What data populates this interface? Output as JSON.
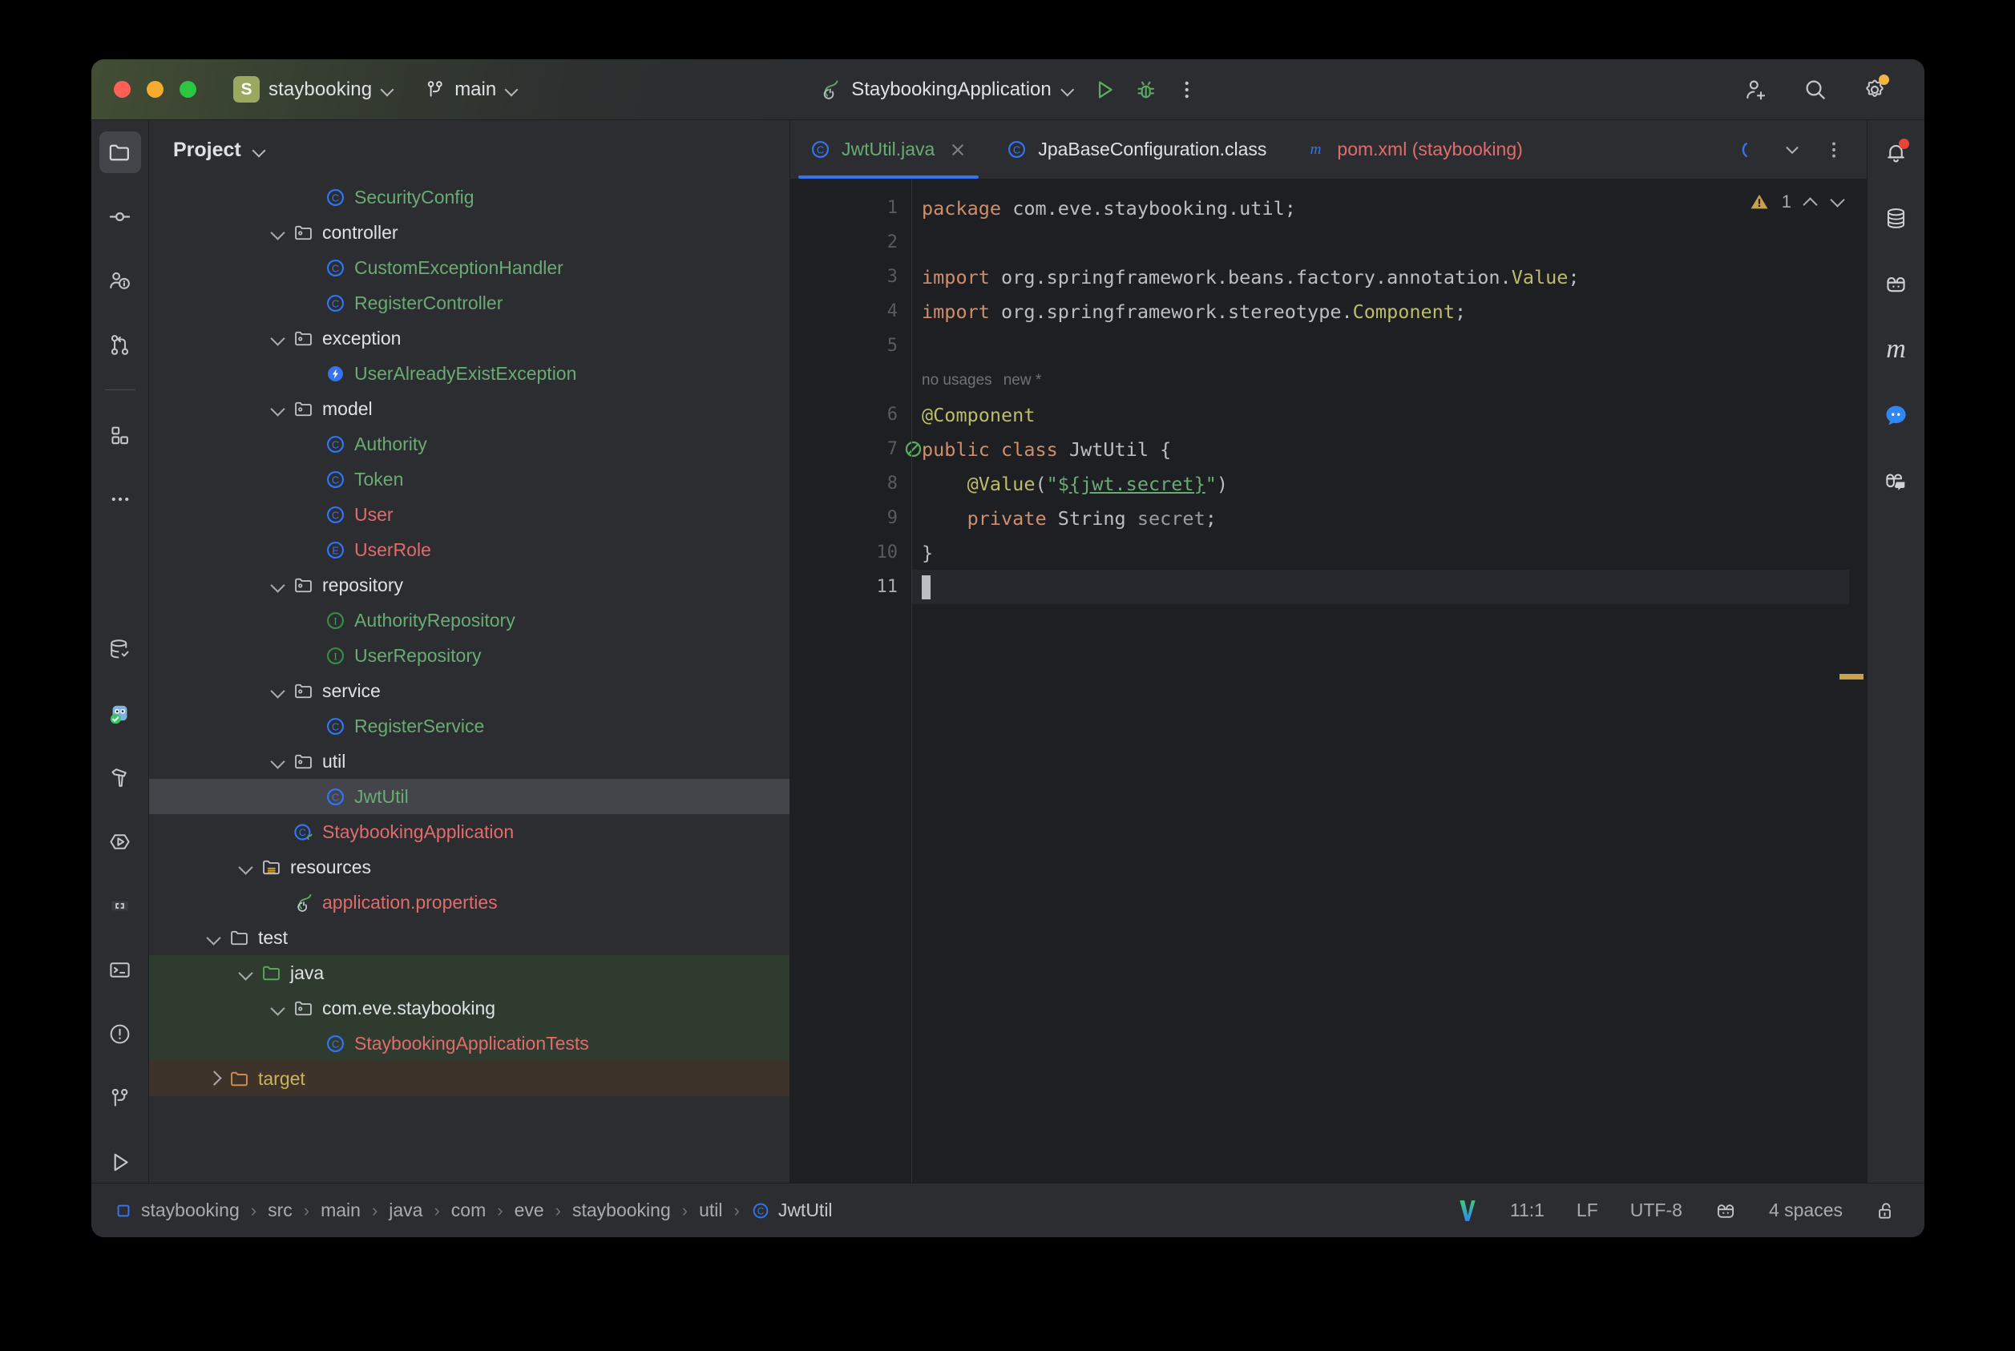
{
  "titlebar": {
    "project_badge": "S",
    "project_name": "staybooking",
    "branch_name": "main",
    "run_config_name": "StaybookingApplication",
    "icons": {
      "traffic_close": "close-window-dot",
      "traffic_minimize": "minimize-window-dot",
      "traffic_maximize": "maximize-window-dot",
      "branch": "vcs-branch-icon",
      "spring": "spring-boot-leaf-icon",
      "run": "run-icon",
      "debug": "debug-icon",
      "more": "more-options-icon",
      "add_user": "add-collaborator-icon",
      "search": "search-everywhere-icon",
      "settings": "settings-gear-icon"
    }
  },
  "left_stripe": {
    "items": [
      {
        "name": "project-tool-window",
        "icon": "folder-icon",
        "active": true
      },
      {
        "name": "commit-tool-window",
        "icon": "commit-node-icon",
        "active": false
      },
      {
        "name": "pull-requests-tool-window",
        "icon": "code-review-icon",
        "active": false
      },
      {
        "name": "git-tool-window",
        "icon": "branch-merge-icon",
        "active": false
      },
      {
        "name": "structure-tool-window",
        "icon": "structure-blocks-icon",
        "active": false
      },
      {
        "name": "more-tool-windows",
        "icon": "ellipsis-icon",
        "active": false
      }
    ],
    "bottom_items": [
      {
        "name": "database-tool-window",
        "icon": "database-check-icon"
      },
      {
        "name": "ai-assistant-tool-window",
        "icon": "ai-owl-icon"
      },
      {
        "name": "build-tool-window",
        "icon": "hammer-icon"
      },
      {
        "name": "run-tool-window",
        "icon": "run-hexagon-icon"
      },
      {
        "name": "debug-console-tool-window",
        "icon": "brackets-icon"
      },
      {
        "name": "terminal-tool-window",
        "icon": "terminal-icon"
      },
      {
        "name": "problems-tool-window",
        "icon": "warning-circle-icon"
      },
      {
        "name": "version-control-tool-window",
        "icon": "branch-icon"
      },
      {
        "name": "services-tool-window",
        "icon": "play-outline-icon"
      }
    ]
  },
  "right_stripe": {
    "items": [
      {
        "name": "notifications",
        "icon": "bell-icon",
        "badge": true
      },
      {
        "name": "database",
        "icon": "database-icon",
        "badge": false
      },
      {
        "name": "codewithme",
        "icon": "code-with-me-icon",
        "badge": false
      },
      {
        "name": "maven",
        "icon": "maven-m-icon",
        "badge": false
      },
      {
        "name": "ai-chat",
        "icon": "chat-bubble-icon",
        "badge": false
      },
      {
        "name": "collaboration",
        "icon": "collaborate-icon",
        "badge": false
      }
    ]
  },
  "project_panel": {
    "title": "Project",
    "tree": [
      {
        "label": "SecurityConfig",
        "indent": 4,
        "arrow": "none",
        "icon": "java-class-icon",
        "color": "c-green",
        "state": "normal"
      },
      {
        "label": "controller",
        "indent": 3,
        "arrow": "down",
        "icon": "package-icon",
        "color": "c-white",
        "state": "normal"
      },
      {
        "label": "CustomExceptionHandler",
        "indent": 4,
        "arrow": "none",
        "icon": "java-class-icon",
        "color": "c-green",
        "state": "normal"
      },
      {
        "label": "RegisterController",
        "indent": 4,
        "arrow": "none",
        "icon": "java-class-icon",
        "color": "c-green",
        "state": "normal"
      },
      {
        "label": "exception",
        "indent": 3,
        "arrow": "down",
        "icon": "package-icon",
        "color": "c-white",
        "state": "normal"
      },
      {
        "label": "UserAlreadyExistException",
        "indent": 4,
        "arrow": "none",
        "icon": "java-exception-icon",
        "color": "c-green",
        "state": "normal"
      },
      {
        "label": "model",
        "indent": 3,
        "arrow": "down",
        "icon": "package-icon",
        "color": "c-white",
        "state": "normal"
      },
      {
        "label": "Authority",
        "indent": 4,
        "arrow": "none",
        "icon": "java-class-icon",
        "color": "c-green",
        "state": "normal"
      },
      {
        "label": "Token",
        "indent": 4,
        "arrow": "none",
        "icon": "java-class-icon",
        "color": "c-green",
        "state": "normal"
      },
      {
        "label": "User",
        "indent": 4,
        "arrow": "none",
        "icon": "java-class-icon",
        "color": "c-red",
        "state": "normal"
      },
      {
        "label": "UserRole",
        "indent": 4,
        "arrow": "none",
        "icon": "java-enum-icon",
        "color": "c-red",
        "state": "normal"
      },
      {
        "label": "repository",
        "indent": 3,
        "arrow": "down",
        "icon": "package-icon",
        "color": "c-white",
        "state": "normal"
      },
      {
        "label": "AuthorityRepository",
        "indent": 4,
        "arrow": "none",
        "icon": "java-interface-icon",
        "color": "c-green",
        "state": "normal"
      },
      {
        "label": "UserRepository",
        "indent": 4,
        "arrow": "none",
        "icon": "java-interface-icon",
        "color": "c-green",
        "state": "normal"
      },
      {
        "label": "service",
        "indent": 3,
        "arrow": "down",
        "icon": "package-icon",
        "color": "c-white",
        "state": "normal"
      },
      {
        "label": "RegisterService",
        "indent": 4,
        "arrow": "none",
        "icon": "java-class-icon",
        "color": "c-green",
        "state": "normal"
      },
      {
        "label": "util",
        "indent": 3,
        "arrow": "down",
        "icon": "package-icon",
        "color": "c-white",
        "state": "normal"
      },
      {
        "label": "JwtUtil",
        "indent": 4,
        "arrow": "none",
        "icon": "java-class-icon",
        "color": "c-green",
        "state": "selected"
      },
      {
        "label": "StaybookingApplication",
        "indent": 3,
        "arrow": "none",
        "icon": "spring-class-icon",
        "color": "c-red",
        "state": "normal"
      },
      {
        "label": "resources",
        "indent": 2,
        "arrow": "down",
        "icon": "resources-folder-icon",
        "color": "c-white",
        "state": "normal"
      },
      {
        "label": "application.properties",
        "indent": 3,
        "arrow": "none",
        "icon": "spring-leaf-icon",
        "color": "c-red",
        "state": "normal"
      },
      {
        "label": "test",
        "indent": 1,
        "arrow": "down",
        "icon": "folder-plain-icon",
        "color": "c-white",
        "state": "normal"
      },
      {
        "label": "java",
        "indent": 2,
        "arrow": "down",
        "icon": "test-source-folder-icon",
        "color": "c-white",
        "state": "testgreen"
      },
      {
        "label": "com.eve.staybooking",
        "indent": 3,
        "arrow": "down",
        "icon": "package-icon",
        "color": "c-white",
        "state": "testgreen"
      },
      {
        "label": "StaybookingApplicationTests",
        "indent": 4,
        "arrow": "none",
        "icon": "java-class-icon",
        "color": "c-red",
        "state": "testgreen"
      },
      {
        "label": "target",
        "indent": 1,
        "arrow": "right",
        "icon": "excluded-folder-icon",
        "color": "c-yellow",
        "state": "excluded"
      }
    ]
  },
  "editor": {
    "tabs": [
      {
        "label": "JwtUtil.java",
        "icon": "java-class-icon",
        "color": "c-green",
        "active": true,
        "closable": true
      },
      {
        "label": "JpaBaseConfiguration.class",
        "icon": "java-class-icon",
        "color": "c-white",
        "active": false,
        "closable": false
      },
      {
        "label": "pom.xml (staybooking)",
        "icon": "maven-m-icon",
        "color": "c-red",
        "active": false,
        "closable": false
      }
    ],
    "tabs_right_icons": {
      "loading": "loading-spinner-icon",
      "chevron": "tab-list-chevron-icon",
      "more": "tab-more-options-icon"
    },
    "inspection": {
      "warning_count": "1",
      "icon": "warning-triangle-icon"
    },
    "gutter_marks": {
      "line7": "spring-bean-gutter-icon"
    },
    "code_hint": {
      "usages": "no usages",
      "author": "new *"
    },
    "lines": [
      {
        "n": "1",
        "tokens": [
          {
            "t": "package",
            "c": "k-kw"
          },
          {
            "t": " com.eve.staybooking.util;",
            "c": "k-plain"
          }
        ]
      },
      {
        "n": "2",
        "tokens": []
      },
      {
        "n": "3",
        "tokens": [
          {
            "t": "import",
            "c": "k-kw"
          },
          {
            "t": " org.springframework.beans.factory.annotation.",
            "c": "k-plain"
          },
          {
            "t": "Value",
            "c": "k-ann"
          },
          {
            "t": ";",
            "c": "k-plain"
          }
        ]
      },
      {
        "n": "4",
        "tokens": [
          {
            "t": "import",
            "c": "k-kw"
          },
          {
            "t": " org.springframework.stereotype.",
            "c": "k-plain"
          },
          {
            "t": "Component",
            "c": "k-ann"
          },
          {
            "t": ";",
            "c": "k-plain"
          }
        ]
      },
      {
        "n": "5",
        "tokens": []
      },
      {
        "n": "6",
        "tokens": [
          {
            "t": "@Component",
            "c": "k-ann"
          }
        ]
      },
      {
        "n": "7",
        "tokens": [
          {
            "t": "public",
            "c": "k-kw"
          },
          {
            "t": " ",
            "c": "k-plain"
          },
          {
            "t": "class",
            "c": "k-kw"
          },
          {
            "t": " JwtUtil {",
            "c": "k-cls"
          }
        ]
      },
      {
        "n": "8",
        "tokens": [
          {
            "t": "    ",
            "c": "k-plain"
          },
          {
            "t": "@Value",
            "c": "k-ann"
          },
          {
            "t": "(",
            "c": "k-plain"
          },
          {
            "t": "\"$",
            "c": "k-str"
          },
          {
            "t": "{jwt.secret}",
            "c": "k-strph"
          },
          {
            "t": "\"",
            "c": "k-str"
          },
          {
            "t": ")",
            "c": "k-plain"
          }
        ]
      },
      {
        "n": "9",
        "tokens": [
          {
            "t": "    ",
            "c": "k-plain"
          },
          {
            "t": "private",
            "c": "k-kw"
          },
          {
            "t": " ",
            "c": "k-plain"
          },
          {
            "t": "String",
            "c": "k-type"
          },
          {
            "t": " ",
            "c": "k-plain"
          },
          {
            "t": "secret",
            "c": "k-field"
          },
          {
            "t": ";",
            "c": "k-plain"
          }
        ]
      },
      {
        "n": "10",
        "tokens": [
          {
            "t": "}",
            "c": "k-plain"
          }
        ]
      },
      {
        "n": "11",
        "tokens": [],
        "current": true,
        "caret": true
      }
    ]
  },
  "statusbar": {
    "breadcrumb": [
      {
        "label": "staybooking",
        "icon": "module-icon"
      },
      {
        "label": "src",
        "icon": ""
      },
      {
        "label": "main",
        "icon": ""
      },
      {
        "label": "java",
        "icon": ""
      },
      {
        "label": "com",
        "icon": ""
      },
      {
        "label": "eve",
        "icon": ""
      },
      {
        "label": "staybooking",
        "icon": ""
      },
      {
        "label": "util",
        "icon": ""
      },
      {
        "label": "JwtUtil",
        "icon": "java-class-icon"
      }
    ],
    "separator": "›",
    "right": {
      "vcs_icon": "vim-idea-icon",
      "caret_position": "11:1",
      "line_separator": "LF",
      "encoding": "UTF-8",
      "codewithme_icon": "code-with-me-icon",
      "indent": "4 spaces",
      "lock_icon": "unlocked-icon"
    }
  },
  "colors": {
    "accent_blue": "#3574f0",
    "green_text": "#6aab73",
    "red_text": "#e06c6c",
    "warning": "#c9a14a",
    "panel_bg": "#2b2d30",
    "editor_bg": "#1e1f22",
    "selection": "#43454a"
  }
}
